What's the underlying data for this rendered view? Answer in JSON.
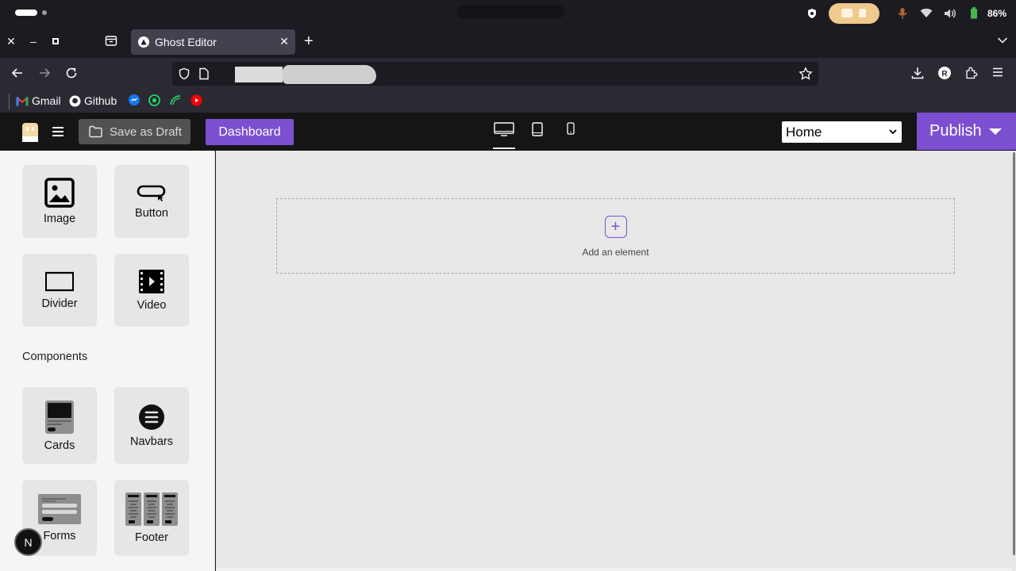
{
  "system": {
    "battery": "86%"
  },
  "browser": {
    "tab_title": "Ghost Editor",
    "bookmarks": [
      "Gmail",
      "Github"
    ]
  },
  "app": {
    "save_draft": "Save as Draft",
    "dashboard": "Dashboard",
    "page_select": "Home",
    "publish": "Publish",
    "accent": "#7c4fd1"
  },
  "sidebar": {
    "elements": [
      "Image",
      "Button",
      "Divider",
      "Video"
    ],
    "components_title": "Components",
    "components": [
      "Cards",
      "Navbars",
      "Forms",
      "Footer"
    ],
    "floating_badge": "N"
  },
  "canvas": {
    "add_element": "Add an element",
    "plus": "+"
  }
}
